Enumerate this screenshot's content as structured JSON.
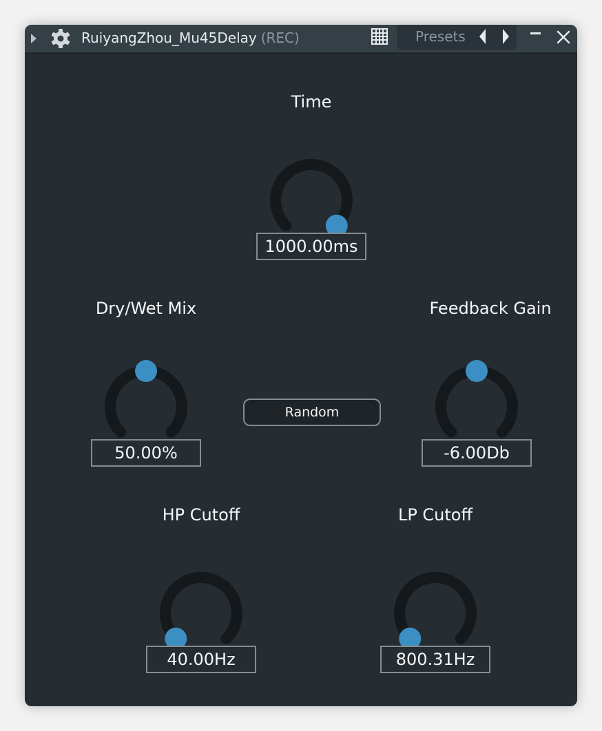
{
  "window": {
    "title": "RuiyangZhou_Mu45Delay",
    "title_suffix": "(REC)",
    "presets_label": "Presets"
  },
  "colors": {
    "accent": "#3b8fc3",
    "track": "#15191c",
    "background": "#252c32"
  },
  "icons": [
    "collapse-arrow-icon",
    "gear-icon",
    "grid-icon",
    "prev-arrow-icon",
    "next-arrow-icon",
    "minimize-icon",
    "close-icon"
  ],
  "controls": {
    "time": {
      "label": "Time",
      "value": "1000.00ms",
      "position": 1.0
    },
    "mix": {
      "label": "Dry/Wet Mix",
      "value": "50.00%",
      "position": 0.5
    },
    "feedback": {
      "label": "Feedback Gain",
      "value": "-6.00Db",
      "position": 0.5
    },
    "hp": {
      "label": "HP Cutoff",
      "value": "40.00Hz",
      "position": 0.0
    },
    "lp": {
      "label": "LP Cutoff",
      "value": "800.31Hz",
      "position": 0.0
    }
  },
  "random_button": {
    "label": "Random"
  }
}
